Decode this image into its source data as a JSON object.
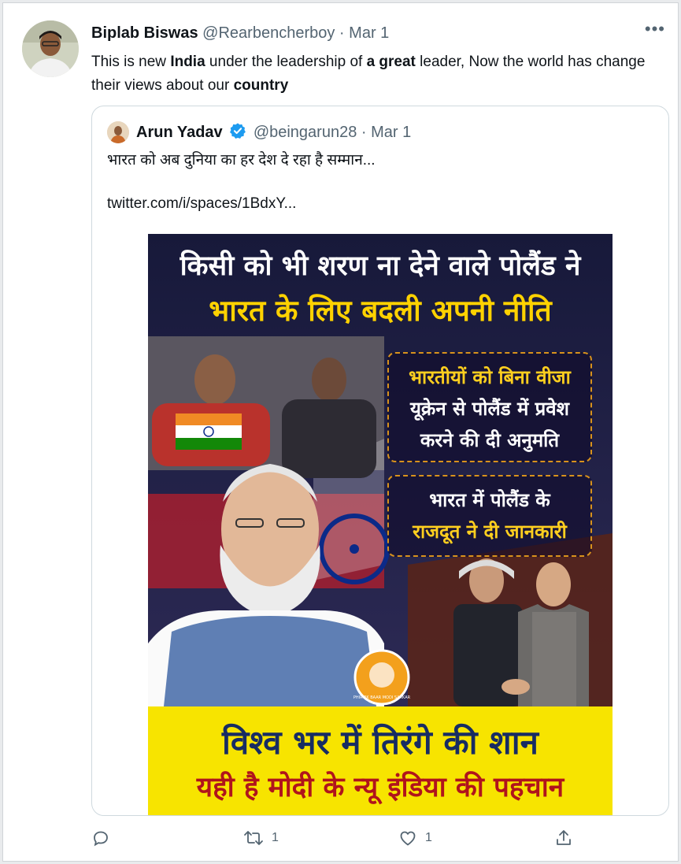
{
  "tweet": {
    "author_name": "Biplab Biswas",
    "handle": "@Rearbencherboy",
    "dot": "·",
    "date": "Mar 1",
    "more": "•••",
    "text": {
      "s1": "This is  new ",
      "b1": "India",
      "s2": " under the leadership of ",
      "b2": "a great",
      "s3": " leader, Now the world has change their views about our ",
      "b3": "country"
    }
  },
  "quoted": {
    "author_name": "Arun Yadav",
    "handle": "@beingarun28",
    "dot": "·",
    "date": "Mar 1",
    "text": "भारत को अब दुनिया का हर देश दे रहा है सम्मान...",
    "link": "twitter.com/i/spaces/1BdxY..."
  },
  "poster": {
    "headline1": "किसी को भी शरण ना देने वाले पोलैंड ने",
    "headline2": "भारत के लिए बदली अपनी नीति",
    "box1": {
      "line1": "भारतीयों को बिना वीजा",
      "line2": "यूक्रेन से पोलैंड में प्रवेश",
      "line3": "करने की दी अनुमति"
    },
    "box2": {
      "line1": "भारत में पोलैंड के",
      "line2": "राजदूत ने दी जानकारी"
    },
    "logo_text": "PHIR EK BAAR MODI SARKAR",
    "banner1": "विश्व भर में तिरंगे की शान",
    "banner2": "यही है मोदी के न्यू इंडिया की पहचान"
  },
  "actions": {
    "reply_count": "",
    "retweet_count": "1",
    "like_count": "1"
  },
  "colors": {
    "verified": "#1d9bf0",
    "muted": "#536471",
    "banner_yellow": "#f7e400"
  }
}
